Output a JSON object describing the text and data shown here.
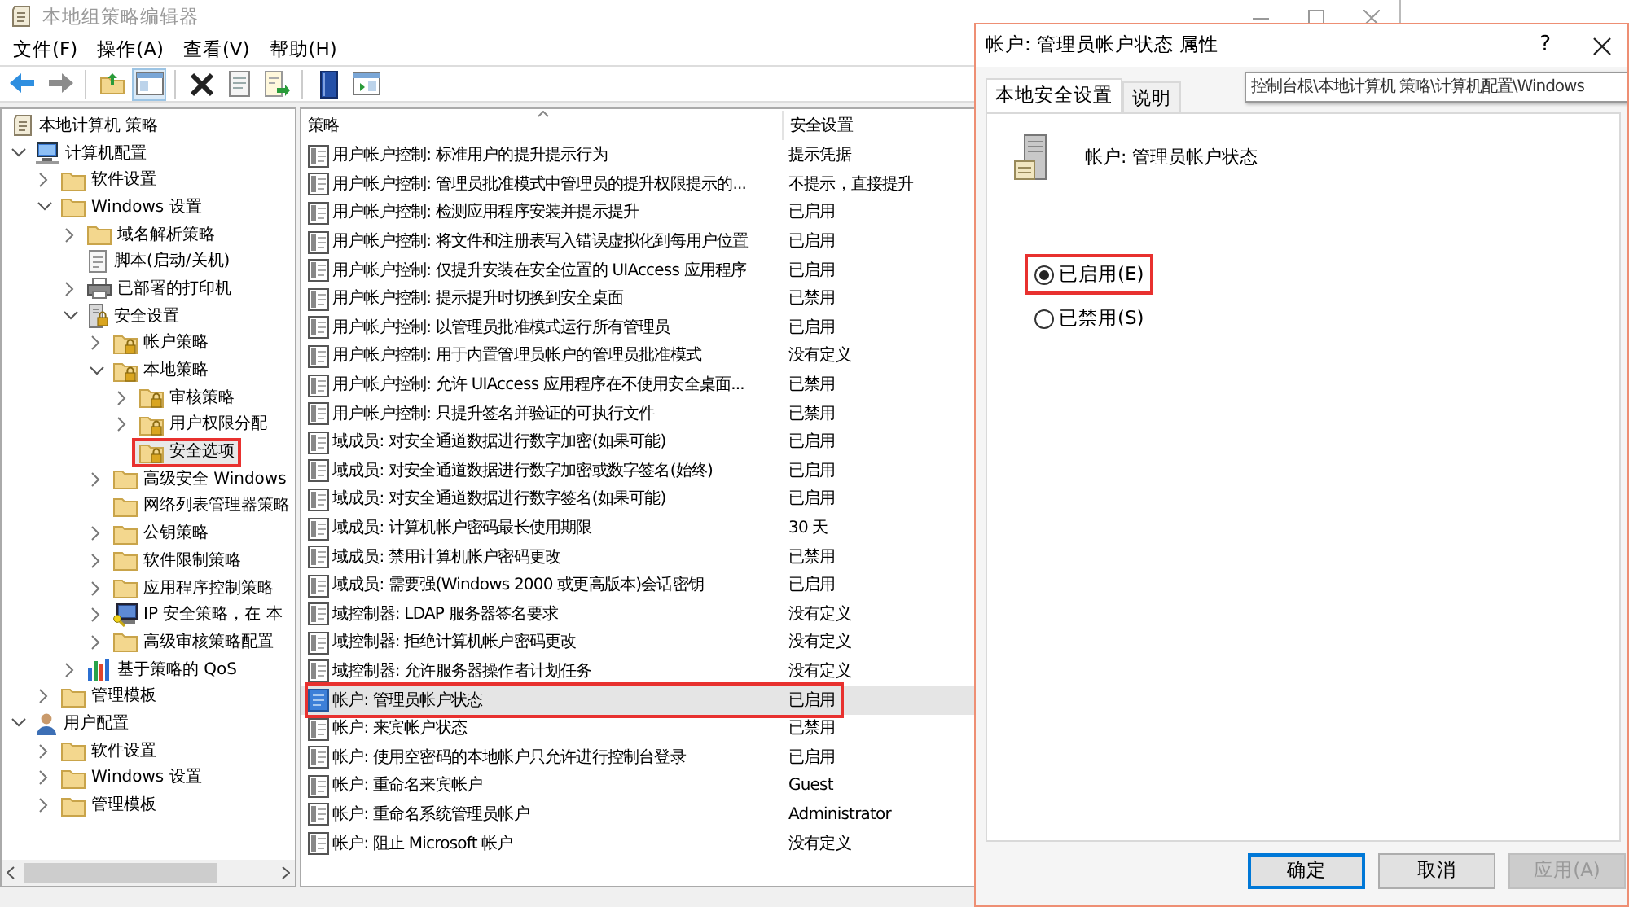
{
  "main_window": {
    "title": "本地组策略编辑器"
  },
  "menu": [
    "文件(F)",
    "操作(A)",
    "查看(V)",
    "帮助(H)"
  ],
  "tree": [
    {
      "label": "本地计算机 策略",
      "kind": "policy",
      "selected": false,
      "highlighted": false,
      "children": [
        {
          "label": "计算机配置",
          "kind": "computer",
          "expanded": true,
          "selected": false,
          "highlighted": false,
          "children": [
            {
              "label": "软件设置",
              "kind": "folder",
              "expanded": false,
              "selected": false,
              "highlighted": false
            },
            {
              "label": "Windows 设置",
              "kind": "folder",
              "expanded": true,
              "selected": false,
              "highlighted": false,
              "children": [
                {
                  "label": "域名解析策略",
                  "kind": "folder",
                  "expanded": false,
                  "selected": false,
                  "highlighted": false
                },
                {
                  "label": "脚本(启动/关机)",
                  "kind": "script",
                  "selected": false,
                  "highlighted": false
                },
                {
                  "label": "已部署的打印机",
                  "kind": "printer",
                  "expanded": false,
                  "selected": false,
                  "highlighted": false
                },
                {
                  "label": "安全设置",
                  "kind": "security",
                  "expanded": true,
                  "selected": false,
                  "highlighted": false,
                  "children": [
                    {
                      "label": "帐户策略",
                      "kind": "lock-folder",
                      "expanded": false,
                      "selected": false,
                      "highlighted": false
                    },
                    {
                      "label": "本地策略",
                      "kind": "lock-folder",
                      "expanded": true,
                      "selected": false,
                      "highlighted": false,
                      "children": [
                        {
                          "label": "审核策略",
                          "kind": "lock-folder",
                          "expanded": false,
                          "selected": false,
                          "highlighted": false
                        },
                        {
                          "label": "用户权限分配",
                          "kind": "lock-folder",
                          "expanded": false,
                          "selected": false,
                          "highlighted": false
                        },
                        {
                          "label": "安全选项",
                          "kind": "lock-folder",
                          "selected": true,
                          "highlighted": true
                        }
                      ]
                    },
                    {
                      "label": "高级安全 Windows",
                      "kind": "folder",
                      "expanded": false,
                      "selected": false,
                      "highlighted": false
                    },
                    {
                      "label": "网络列表管理器策略",
                      "kind": "folder",
                      "selected": false,
                      "highlighted": false
                    },
                    {
                      "label": "公钥策略",
                      "kind": "folder",
                      "expanded": false,
                      "selected": false,
                      "highlighted": false
                    },
                    {
                      "label": "软件限制策略",
                      "kind": "folder",
                      "expanded": false,
                      "selected": false,
                      "highlighted": false
                    },
                    {
                      "label": "应用程序控制策略",
                      "kind": "folder",
                      "expanded": false,
                      "selected": false,
                      "highlighted": false
                    },
                    {
                      "label": "IP 安全策略，在 本",
                      "kind": "ip-security",
                      "expanded": false,
                      "selected": false,
                      "highlighted": false
                    },
                    {
                      "label": "高级审核策略配置",
                      "kind": "folder",
                      "expanded": false,
                      "selected": false,
                      "highlighted": false
                    }
                  ]
                },
                {
                  "label": "基于策略的 QoS",
                  "kind": "chart",
                  "expanded": false,
                  "selected": false,
                  "highlighted": false
                }
              ]
            },
            {
              "label": "管理模板",
              "kind": "folder",
              "expanded": false,
              "selected": false,
              "highlighted": false
            }
          ]
        },
        {
          "label": "用户配置",
          "kind": "user",
          "expanded": true,
          "selected": false,
          "highlighted": false,
          "children": [
            {
              "label": "软件设置",
              "kind": "folder",
              "expanded": false,
              "selected": false,
              "highlighted": false
            },
            {
              "label": "Windows 设置",
              "kind": "folder",
              "expanded": false,
              "selected": false,
              "highlighted": false
            },
            {
              "label": "管理模板",
              "kind": "folder",
              "expanded": false,
              "selected": false,
              "highlighted": false
            }
          ]
        }
      ]
    }
  ],
  "list": {
    "columns": [
      "策略",
      "安全设置"
    ],
    "rows": [
      {
        "policy": "用户帐户控制: 标准用户的提升提示行为",
        "setting": "提示凭据",
        "selected": false,
        "highlighted": false
      },
      {
        "policy": "用户帐户控制: 管理员批准模式中管理员的提升权限提示的...",
        "setting": "不提示，直接提升",
        "selected": false,
        "highlighted": false
      },
      {
        "policy": "用户帐户控制: 检测应用程序安装并提示提升",
        "setting": "已启用",
        "selected": false,
        "highlighted": false
      },
      {
        "policy": "用户帐户控制: 将文件和注册表写入错误虚拟化到每用户位置",
        "setting": "已启用",
        "selected": false,
        "highlighted": false
      },
      {
        "policy": "用户帐户控制: 仅提升安装在安全位置的 UIAccess 应用程序",
        "setting": "已启用",
        "selected": false,
        "highlighted": false
      },
      {
        "policy": "用户帐户控制: 提示提升时切换到安全桌面",
        "setting": "已禁用",
        "selected": false,
        "highlighted": false
      },
      {
        "policy": "用户帐户控制: 以管理员批准模式运行所有管理员",
        "setting": "已启用",
        "selected": false,
        "highlighted": false
      },
      {
        "policy": "用户帐户控制: 用于内置管理员帐户的管理员批准模式",
        "setting": "没有定义",
        "selected": false,
        "highlighted": false
      },
      {
        "policy": "用户帐户控制: 允许 UIAccess 应用程序在不使用安全桌面...",
        "setting": "已禁用",
        "selected": false,
        "highlighted": false
      },
      {
        "policy": "用户帐户控制: 只提升签名并验证的可执行文件",
        "setting": "已禁用",
        "selected": false,
        "highlighted": false
      },
      {
        "policy": "域成员: 对安全通道数据进行数字加密(如果可能)",
        "setting": "已启用",
        "selected": false,
        "highlighted": false
      },
      {
        "policy": "域成员: 对安全通道数据进行数字加密或数字签名(始终)",
        "setting": "已启用",
        "selected": false,
        "highlighted": false
      },
      {
        "policy": "域成员: 对安全通道数据进行数字签名(如果可能)",
        "setting": "已启用",
        "selected": false,
        "highlighted": false
      },
      {
        "policy": "域成员: 计算机帐户密码最长使用期限",
        "setting": "30 天",
        "selected": false,
        "highlighted": false
      },
      {
        "policy": "域成员: 禁用计算机帐户密码更改",
        "setting": "已禁用",
        "selected": false,
        "highlighted": false
      },
      {
        "policy": "域成员: 需要强(Windows 2000 或更高版本)会话密钥",
        "setting": "已启用",
        "selected": false,
        "highlighted": false
      },
      {
        "policy": "域控制器: LDAP 服务器签名要求",
        "setting": "没有定义",
        "selected": false,
        "highlighted": false
      },
      {
        "policy": "域控制器: 拒绝计算机帐户密码更改",
        "setting": "没有定义",
        "selected": false,
        "highlighted": false
      },
      {
        "policy": "域控制器: 允许服务器操作者计划任务",
        "setting": "没有定义",
        "selected": false,
        "highlighted": false
      },
      {
        "policy": "帐户: 管理员帐户状态",
        "setting": "已启用",
        "selected": true,
        "highlighted": true
      },
      {
        "policy": "帐户: 来宾帐户状态",
        "setting": "已禁用",
        "selected": false,
        "highlighted": false
      },
      {
        "policy": "帐户: 使用空密码的本地帐户只允许进行控制台登录",
        "setting": "已启用",
        "selected": false,
        "highlighted": false
      },
      {
        "policy": "帐户: 重命名来宾帐户",
        "setting": "Guest",
        "selected": false,
        "highlighted": false
      },
      {
        "policy": "帐户: 重命名系统管理员帐户",
        "setting": "Administrator",
        "selected": false,
        "highlighted": false
      },
      {
        "policy": "帐户: 阻止 Microsoft 帐户",
        "setting": "没有定义",
        "selected": false,
        "highlighted": false
      }
    ]
  },
  "dialog": {
    "title": "帐户: 管理员帐户状态 属性",
    "help": "?",
    "tabs": [
      {
        "label": "本地安全设置",
        "selected": true
      },
      {
        "label": "说明",
        "selected": false
      }
    ],
    "path_tooltip": "控制台根\\本地计算机 策略\\计算机配置\\Windows",
    "policy_name": "帐户: 管理员帐户状态",
    "options": [
      {
        "label": "已启用(E)",
        "selected": true,
        "highlighted": true
      },
      {
        "label": "已禁用(S)",
        "selected": false,
        "highlighted": false
      }
    ],
    "buttons": [
      {
        "label": "确定",
        "kind": "default",
        "disabled": false
      },
      {
        "label": "取消",
        "kind": "normal",
        "disabled": false
      },
      {
        "label": "应用(A)",
        "kind": "normal",
        "disabled": true
      }
    ]
  }
}
